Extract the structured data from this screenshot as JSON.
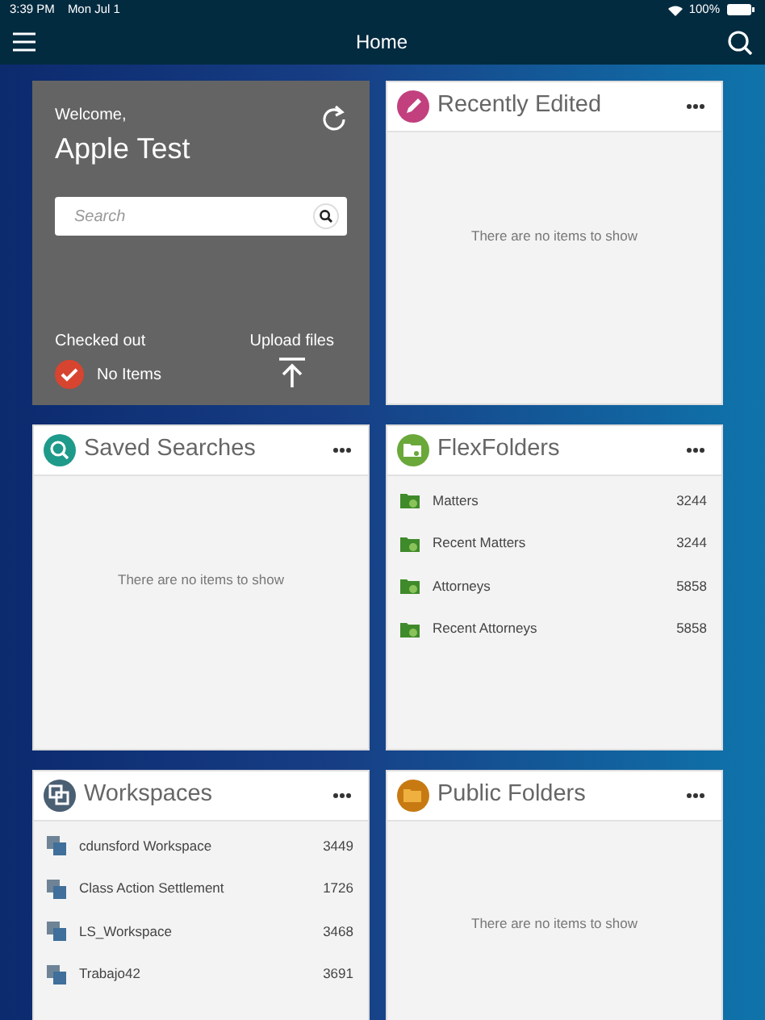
{
  "status_bar": {
    "time": "3:39 PM",
    "date": "Mon Jul 1",
    "battery": "100%"
  },
  "nav": {
    "title": "Home"
  },
  "panels": [
    {
      "kind": "welcome",
      "greeting": "Welcome,",
      "user": "Apple Test",
      "search": {
        "placeholder": "Search"
      },
      "checked_out": {
        "label": "Checked out",
        "value": "No Items"
      },
      "upload": "Upload files"
    },
    {
      "kind": "empty",
      "title": "Recently Edited",
      "color": "#c2407e",
      "message": "There are no items to show"
    },
    {
      "kind": "empty",
      "title": "Saved Searches",
      "color": "#1e9a8a",
      "message": "There are no items to show"
    },
    {
      "kind": "list",
      "title": "FlexFolders",
      "color": "#6aa83a",
      "items": [
        {
          "name": "Matters",
          "count": "3244"
        },
        {
          "name": "Recent Matters",
          "count": "3244"
        },
        {
          "name": "Attorneys",
          "count": "5858"
        },
        {
          "name": "Recent Attorneys",
          "count": "5858"
        }
      ]
    },
    {
      "kind": "list",
      "title": "Workspaces",
      "color": "#4a5f72",
      "items": [
        {
          "name": "cdunsford Workspace",
          "count": "3449"
        },
        {
          "name": "Class Action Settlement",
          "count": "1726"
        },
        {
          "name": "LS_Workspace",
          "count": "3468"
        },
        {
          "name": "Trabajo42",
          "count": "3691"
        }
      ]
    },
    {
      "kind": "empty",
      "title": "Public Folders",
      "color": "#c87a12",
      "message": "There are no items to show"
    }
  ]
}
